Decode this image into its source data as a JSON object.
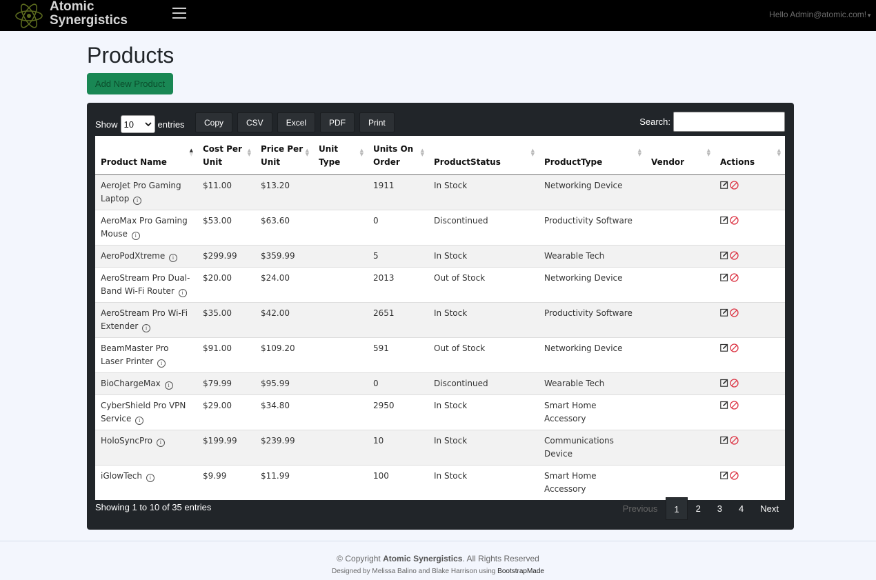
{
  "header": {
    "logo_line1": "Atomic",
    "logo_line2": "Synergistics",
    "user_greeting": "Hello Admin@atomic.com!",
    "menu_icon": "hamburger-icon",
    "logo_icon": "atom-icon"
  },
  "page": {
    "title": "Products",
    "add_button": "Add New Product"
  },
  "toolbar": {
    "show_label": "Show",
    "entries_label": "entries",
    "page_length": "10",
    "buttons": [
      "Copy",
      "CSV",
      "Excel",
      "PDF",
      "Print"
    ],
    "search_label": "Search:"
  },
  "table": {
    "columns": [
      "Product Name",
      "Cost Per Unit",
      "Price Per Unit",
      "Unit Type",
      "Units On Order",
      "ProductStatus",
      "ProductType",
      "Vendor",
      "Actions"
    ],
    "rows": [
      {
        "name": "AeroJet Pro Gaming Laptop",
        "cost": "$11.00",
        "price": "$13.20",
        "unit_type": "",
        "on_order": "1911",
        "status": "In Stock",
        "type": "Networking Device",
        "vendor": ""
      },
      {
        "name": "AeroMax Pro Gaming Mouse",
        "cost": "$53.00",
        "price": "$63.60",
        "unit_type": "",
        "on_order": "0",
        "status": "Discontinued",
        "type": "Productivity Software",
        "vendor": ""
      },
      {
        "name": "AeroPodXtreme",
        "cost": "$299.99",
        "price": "$359.99",
        "unit_type": "",
        "on_order": "5",
        "status": "In Stock",
        "type": "Wearable Tech",
        "vendor": ""
      },
      {
        "name": "AeroStream Pro Dual-Band Wi-Fi Router",
        "cost": "$20.00",
        "price": "$24.00",
        "unit_type": "",
        "on_order": "2013",
        "status": "Out of Stock",
        "type": "Networking Device",
        "vendor": ""
      },
      {
        "name": "AeroStream Pro Wi-Fi Extender",
        "cost": "$35.00",
        "price": "$42.00",
        "unit_type": "",
        "on_order": "2651",
        "status": "In Stock",
        "type": "Productivity Software",
        "vendor": ""
      },
      {
        "name": "BeamMaster Pro Laser Printer",
        "cost": "$91.00",
        "price": "$109.20",
        "unit_type": "",
        "on_order": "591",
        "status": "Out of Stock",
        "type": "Networking Device",
        "vendor": ""
      },
      {
        "name": "BioChargeMax",
        "cost": "$79.99",
        "price": "$95.99",
        "unit_type": "",
        "on_order": "0",
        "status": "Discontinued",
        "type": "Wearable Tech",
        "vendor": ""
      },
      {
        "name": "CyberShield Pro VPN Service",
        "cost": "$29.00",
        "price": "$34.80",
        "unit_type": "",
        "on_order": "2950",
        "status": "In Stock",
        "type": "Smart Home Accessory",
        "vendor": ""
      },
      {
        "name": "HoloSyncPro",
        "cost": "$199.99",
        "price": "$239.99",
        "unit_type": "",
        "on_order": "10",
        "status": "In Stock",
        "type": "Communications Device",
        "vendor": ""
      },
      {
        "name": "iGlowTech",
        "cost": "$9.99",
        "price": "$11.99",
        "unit_type": "",
        "on_order": "100",
        "status": "In Stock",
        "type": "Smart Home Accessory",
        "vendor": ""
      }
    ]
  },
  "footer_table": {
    "info": "Showing 1 to 10 of 35 entries",
    "previous": "Previous",
    "pages": [
      "1",
      "2",
      "3",
      "4"
    ],
    "current_page": "1",
    "next": "Next"
  },
  "footer": {
    "copyright_prefix": "© Copyright",
    "company": "Atomic Synergistics",
    "copyright_suffix": ". All Rights Reserved",
    "designed_by": "Designed by Melissa Balino and Blake Harrison using",
    "bootstrapmade": "BootstrapMade"
  },
  "colors": {
    "header_bg": "#000000",
    "card_bg": "#212529",
    "add_button_bg": "#198754",
    "delete_icon": "#dc3545"
  }
}
